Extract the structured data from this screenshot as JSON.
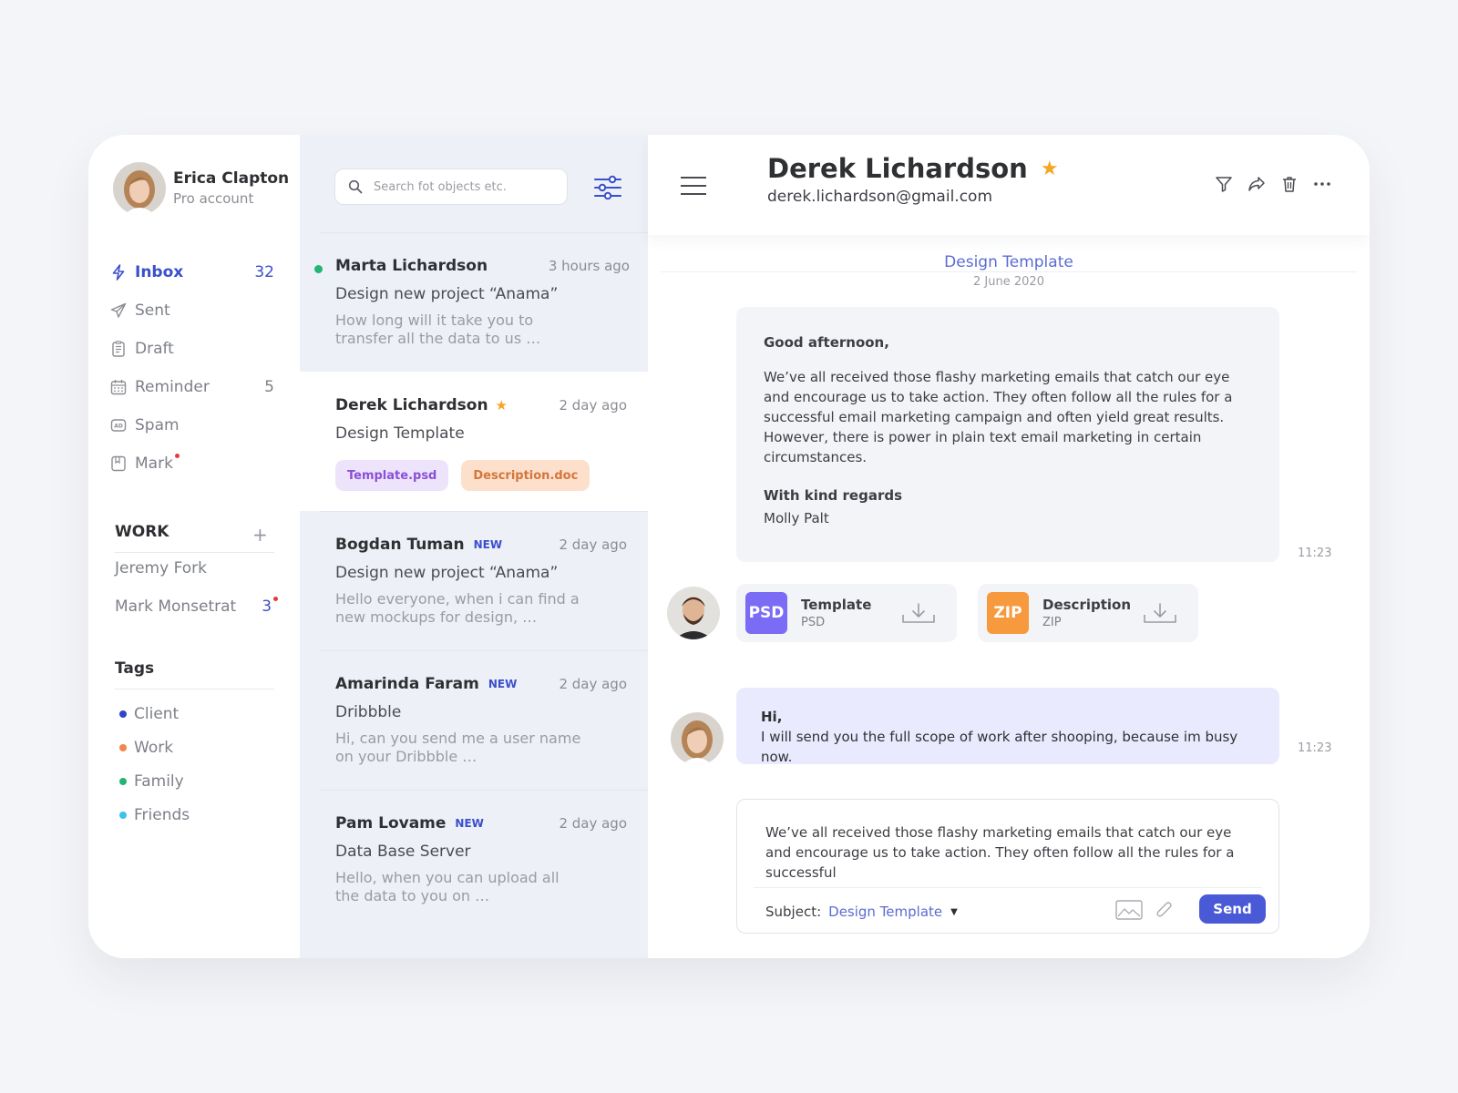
{
  "profile": {
    "name": "Erica Clapton",
    "role": "Pro account"
  },
  "nav": [
    {
      "label": "Inbox",
      "count": "32",
      "icon": "lightning-icon"
    },
    {
      "label": "Sent",
      "count": "",
      "icon": "paper-plane-icon"
    },
    {
      "label": "Draft",
      "count": "",
      "icon": "document-icon"
    },
    {
      "label": "Reminder",
      "count": "5",
      "icon": "calendar-icon"
    },
    {
      "label": "Spam",
      "count": "",
      "icon": "ad-icon"
    },
    {
      "label": "Mark",
      "count": "",
      "icon": "bookmark-icon"
    }
  ],
  "work": {
    "title": "WORK",
    "people": [
      {
        "name": "Jeremy Fork",
        "count": ""
      },
      {
        "name": "Mark Monsetrat",
        "count": "3"
      }
    ]
  },
  "tags": {
    "title": "Tags",
    "items": [
      {
        "label": "Client",
        "color": "#2f45c8"
      },
      {
        "label": "Work",
        "color": "#f0874b"
      },
      {
        "label": "Family",
        "color": "#22b573"
      },
      {
        "label": "Friends",
        "color": "#3cc2ef"
      }
    ]
  },
  "search": {
    "placeholder": "Search fot objects etc."
  },
  "messages": [
    {
      "sender": "Marta Lichardson",
      "time": "3 hours ago",
      "subject": "Design new project “Anama”",
      "preview": "How long will it take you to transfer all the data to us …"
    },
    {
      "sender": "Derek Lichardson",
      "time": "2 day ago",
      "subject": "Design Template",
      "attachments": [
        "Template.psd",
        "Description.doc"
      ]
    },
    {
      "sender": "Bogdan Tuman",
      "badge": "NEW",
      "time": "2 day ago",
      "subject": "Design new project “Anama”",
      "preview": "Hello everyone, when i can find a new mockups for design, …"
    },
    {
      "sender": "Amarinda Faram",
      "badge": "NEW",
      "time": "2 day ago",
      "subject": "Dribbble",
      "preview": "Hi, can you send me a user name on your Dribbble …"
    },
    {
      "sender": "Pam Lovame",
      "badge": "NEW",
      "time": "2 day ago",
      "subject": "Data Base Server",
      "preview": "Hello, when you can upload all the data to you on …"
    }
  ],
  "contact": {
    "name": "Derek Lichardson",
    "email": "derek.lichardson@gmail.com",
    "star": "★"
  },
  "thread": {
    "subject": "Design Template",
    "date": "2 June 2020",
    "email": {
      "greeting": "Good afternoon,",
      "body": "We’ve all received those flashy marketing emails that catch our eye and encourage us to take action. They often follow all the rules for a successful email marketing campaign and often yield great results. However, there is power in plain text email marketing in certain circumstances.",
      "regards": "With kind regards",
      "signature": "Molly Palt",
      "time": "11:23"
    },
    "attachments": [
      {
        "badge": "PSD",
        "name": "Template",
        "type": "PSD",
        "color": "#7b6cf6"
      },
      {
        "badge": "ZIP",
        "name": "Description",
        "type": "ZIP",
        "color": "#f79a3e"
      }
    ],
    "reply": {
      "greeting": "Hi,",
      "body": "I will send you the full scope of work after shooping, because im busy now.",
      "time": "11:23"
    }
  },
  "composer": {
    "text": "We’ve all received those flashy marketing emails that catch our eye and encourage us to take action. They often follow all the rules for a successful",
    "subject_label": "Subject:",
    "subject_value": "Design Template",
    "send_label": "Send"
  },
  "colors": {
    "accent": "#3b4fcb",
    "star": "#f5a623",
    "online": "#22b573"
  }
}
